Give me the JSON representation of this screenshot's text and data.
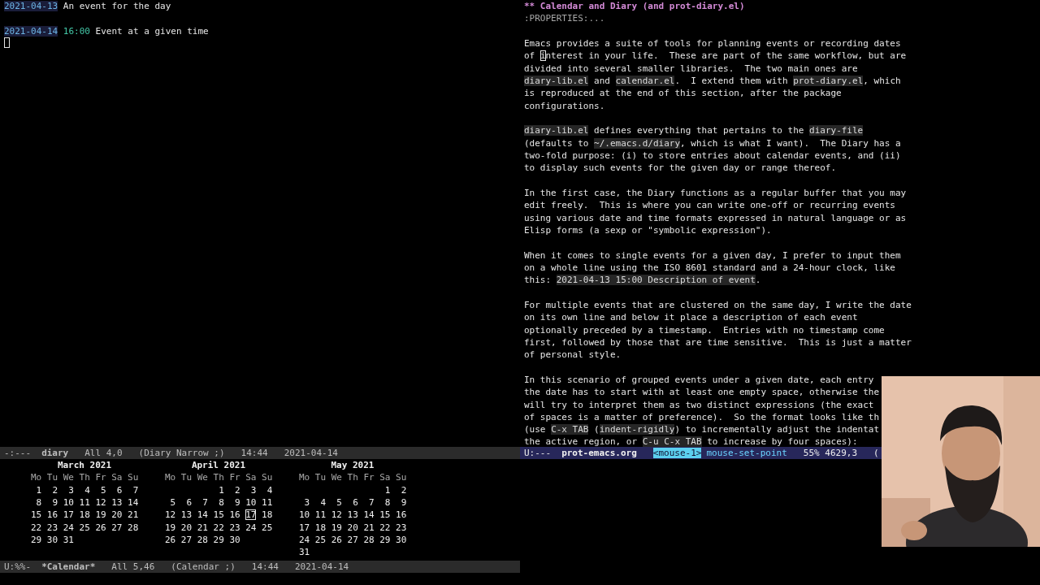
{
  "diary_window": {
    "entries": [
      {
        "date": "2021-04-13",
        "text": "An event for the day"
      },
      {
        "date": "2021-04-14",
        "time": "16:00",
        "text": "Event at a given time"
      }
    ],
    "cursor": true,
    "mode_line": {
      "active": false,
      "segments": [
        {
          "kind": "flags",
          "text": "-:---"
        },
        {
          "kind": "buffer",
          "text": "diary"
        },
        {
          "kind": "plain",
          "text": "All 4,0"
        },
        {
          "kind": "plain",
          "text": "(Diary Narrow ;)"
        },
        {
          "kind": "plain",
          "text": "14:44"
        },
        {
          "kind": "plain",
          "text": "2021-04-14"
        }
      ]
    }
  },
  "calendar_window": {
    "months": [
      {
        "title": "March 2021",
        "weekdays": [
          "Mo",
          "Tu",
          "We",
          "Th",
          "Fr",
          "Sa",
          "Su"
        ],
        "weeks": [
          [
            {
              "day": "1",
              "selected": false
            },
            {
              "day": "2",
              "selected": false
            },
            {
              "day": "3",
              "selected": false
            },
            {
              "day": "4",
              "selected": false
            },
            {
              "day": "5",
              "selected": false
            },
            {
              "day": "6",
              "selected": false
            },
            {
              "day": "7",
              "selected": false
            }
          ],
          [
            {
              "day": "8",
              "selected": false
            },
            {
              "day": "9",
              "selected": false
            },
            {
              "day": "10",
              "selected": false
            },
            {
              "day": "11",
              "selected": false
            },
            {
              "day": "12",
              "selected": false
            },
            {
              "day": "13",
              "selected": false
            },
            {
              "day": "14",
              "selected": false
            }
          ],
          [
            {
              "day": "15",
              "selected": false
            },
            {
              "day": "16",
              "selected": false
            },
            {
              "day": "17",
              "selected": false
            },
            {
              "day": "18",
              "selected": false
            },
            {
              "day": "19",
              "selected": false
            },
            {
              "day": "20",
              "selected": false
            },
            {
              "day": "21",
              "selected": false
            }
          ],
          [
            {
              "day": "22",
              "selected": false
            },
            {
              "day": "23",
              "selected": false
            },
            {
              "day": "24",
              "selected": false
            },
            {
              "day": "25",
              "selected": false
            },
            {
              "day": "26",
              "selected": false
            },
            {
              "day": "27",
              "selected": false
            },
            {
              "day": "28",
              "selected": false
            }
          ],
          [
            {
              "day": "29",
              "selected": false
            },
            {
              "day": "30",
              "selected": false
            },
            {
              "day": "31",
              "selected": false
            }
          ]
        ]
      },
      {
        "title": "April 2021",
        "weekdays": [
          "Mo",
          "Tu",
          "We",
          "Th",
          "Fr",
          "Sa",
          "Su"
        ],
        "weeks": [
          {
            "kind": "leading",
            "days": [
              {
                "day": "1",
                "selected": false
              },
              {
                "day": "2",
                "selected": false
              },
              {
                "day": "3",
                "selected": false
              },
              {
                "day": "4",
                "selected": false
              }
            ]
          },
          [
            {
              "day": "5",
              "selected": false
            },
            {
              "day": "6",
              "selected": false
            },
            {
              "day": "7",
              "selected": false
            },
            {
              "day": "8",
              "selected": false
            },
            {
              "day": "9",
              "selected": false
            },
            {
              "day": "10",
              "selected": false
            },
            {
              "day": "11",
              "selected": false
            }
          ],
          [
            {
              "day": "12",
              "selected": false
            },
            {
              "day": "13",
              "selected": false
            },
            {
              "day": "14",
              "selected": false
            },
            {
              "day": "15",
              "selected": false
            },
            {
              "day": "16",
              "selected": false
            },
            {
              "day": "17",
              "selected": true
            },
            {
              "day": "18",
              "selected": false
            }
          ],
          [
            {
              "day": "19",
              "selected": false
            },
            {
              "day": "20",
              "selected": false
            },
            {
              "day": "21",
              "selected": false
            },
            {
              "day": "22",
              "selected": false
            },
            {
              "day": "23",
              "selected": false
            },
            {
              "day": "24",
              "selected": false
            },
            {
              "day": "25",
              "selected": false
            }
          ],
          [
            {
              "day": "26",
              "selected": false
            },
            {
              "day": "27",
              "selected": false
            },
            {
              "day": "28",
              "selected": false
            },
            {
              "day": "29",
              "selected": false
            },
            {
              "day": "30",
              "selected": false
            }
          ]
        ]
      },
      {
        "title": "May 2021",
        "weekdays": [
          "Mo",
          "Tu",
          "We",
          "Th",
          "Fr",
          "Sa",
          "Su"
        ],
        "weeks": [
          {
            "kind": "leading",
            "days": [
              {
                "day": "1",
                "selected": false
              },
              {
                "day": "2",
                "selected": false
              }
            ]
          },
          [
            {
              "day": "3",
              "selected": false
            },
            {
              "day": "4",
              "selected": false
            },
            {
              "day": "5",
              "selected": false
            },
            {
              "day": "6",
              "selected": false
            },
            {
              "day": "7",
              "selected": false
            },
            {
              "day": "8",
              "selected": false
            },
            {
              "day": "9",
              "selected": false
            }
          ],
          [
            {
              "day": "10",
              "selected": false
            },
            {
              "day": "11",
              "selected": false
            },
            {
              "day": "12",
              "selected": false
            },
            {
              "day": "13",
              "selected": false
            },
            {
              "day": "14",
              "selected": false
            },
            {
              "day": "15",
              "selected": false
            },
            {
              "day": "16",
              "selected": false
            }
          ],
          [
            {
              "day": "17",
              "selected": false
            },
            {
              "day": "18",
              "selected": false
            },
            {
              "day": "19",
              "selected": false
            },
            {
              "day": "20",
              "selected": false
            },
            {
              "day": "21",
              "selected": false
            },
            {
              "day": "22",
              "selected": false
            },
            {
              "day": "23",
              "selected": false
            }
          ],
          [
            {
              "day": "24",
              "selected": false
            },
            {
              "day": "25",
              "selected": false
            },
            {
              "day": "26",
              "selected": false
            },
            {
              "day": "27",
              "selected": false
            },
            {
              "day": "28",
              "selected": false
            },
            {
              "day": "29",
              "selected": false
            },
            {
              "day": "30",
              "selected": false
            }
          ],
          [
            {
              "day": "31",
              "selected": false
            }
          ]
        ]
      }
    ],
    "mode_line": {
      "active": false,
      "segments": [
        {
          "kind": "flags",
          "text": "U:%%-"
        },
        {
          "kind": "buffer",
          "text": "*Calendar*"
        },
        {
          "kind": "plain",
          "text": "All 5,46"
        },
        {
          "kind": "plain",
          "text": "(Calendar ;)"
        },
        {
          "kind": "plain",
          "text": "14:44"
        },
        {
          "kind": "plain",
          "text": "2021-04-14"
        }
      ]
    }
  },
  "org_window": {
    "heading": "** Calendar and Diary (and prot-diary.el)",
    "properties": ":PROPERTIES:...",
    "paragraphs": [
      [
        [
          {
            "kind": "text",
            "text": "Emacs provides a suite of tools for planning events or recording dates"
          }
        ],
        [
          {
            "kind": "text",
            "text": "of "
          },
          {
            "kind": "cursor",
            "text": "i"
          },
          {
            "kind": "text",
            "text": "nterest in your life.  These are part of the same workflow, but are"
          }
        ],
        [
          {
            "kind": "text",
            "text": "divided into several smaller libraries.  The two main ones are"
          }
        ],
        [
          {
            "kind": "code",
            "text": "diary-lib.el"
          },
          {
            "kind": "text",
            "text": " and "
          },
          {
            "kind": "code",
            "text": "calendar.el"
          },
          {
            "kind": "text",
            "text": ".  I extend them with "
          },
          {
            "kind": "code",
            "text": "prot-diary.el"
          },
          {
            "kind": "text",
            "text": ", which"
          }
        ],
        [
          {
            "kind": "text",
            "text": "is reproduced at the end of this section, after the package"
          }
        ],
        [
          {
            "kind": "text",
            "text": "configurations."
          }
        ]
      ],
      [
        [
          {
            "kind": "code",
            "text": "diary-lib.el"
          },
          {
            "kind": "text",
            "text": " defines everything that pertains to the "
          },
          {
            "kind": "code",
            "text": "diary-file"
          }
        ],
        [
          {
            "kind": "text",
            "text": "(defaults to "
          },
          {
            "kind": "code",
            "text": "~/.emacs.d/diary"
          },
          {
            "kind": "text",
            "text": ", which is what I want).  The Diary has a"
          }
        ],
        [
          {
            "kind": "text",
            "text": "two-fold purpose: (i) to store entries about calendar events, and (ii)"
          }
        ],
        [
          {
            "kind": "text",
            "text": "to display such events for the given day or range thereof."
          }
        ]
      ],
      [
        [
          {
            "kind": "text",
            "text": "In the first case, the Diary functions as a regular buffer that you may"
          }
        ],
        [
          {
            "kind": "text",
            "text": "edit freely.  This is where you can write one-off or recurring events"
          }
        ],
        [
          {
            "kind": "text",
            "text": "using various date and time formats expressed in natural language or as"
          }
        ],
        [
          {
            "kind": "text",
            "text": "Elisp forms (a sexp or \"symbolic expression\")."
          }
        ]
      ],
      [
        [
          {
            "kind": "text",
            "text": "When it comes to single events for a given day, I prefer to input them"
          }
        ],
        [
          {
            "kind": "text",
            "text": "on a whole line using the ISO 8601 standard and a 24-hour clock, like"
          }
        ],
        [
          {
            "kind": "text",
            "text": "this: "
          },
          {
            "kind": "code",
            "text": "2021-04-13 15:00 Description of event"
          },
          {
            "kind": "text",
            "text": "."
          }
        ]
      ],
      [
        [
          {
            "kind": "text",
            "text": "For multiple events that are clustered on the same day, I write the date"
          }
        ],
        [
          {
            "kind": "text",
            "text": "on its own line and below it place a description of each event"
          }
        ],
        [
          {
            "kind": "text",
            "text": "optionally preceded by a timestamp.  Entries with no timestamp come"
          }
        ],
        [
          {
            "kind": "text",
            "text": "first, followed by those that are time sensitive.  This is just a matter"
          }
        ],
        [
          {
            "kind": "text",
            "text": "of personal style."
          }
        ]
      ],
      [
        [
          {
            "kind": "text",
            "text": "In this scenario of grouped events under a given date, each entry"
          }
        ],
        [
          {
            "kind": "text",
            "text": "the date has to start with at least one empty space, otherwise the"
          }
        ],
        [
          {
            "kind": "text",
            "text": "will try to interpret them as two distinct expressions (the exact"
          }
        ],
        [
          {
            "kind": "text",
            "text": "of spaces is a matter of preference).  So the format looks like th"
          }
        ],
        [
          {
            "kind": "text",
            "text": "(use "
          },
          {
            "kind": "code",
            "text": "C-x TAB"
          },
          {
            "kind": "text",
            "text": " ("
          },
          {
            "kind": "code",
            "text": "indent-rigidly"
          },
          {
            "kind": "text",
            "text": ") to incrementally adjust the indentat"
          }
        ],
        [
          {
            "kind": "text",
            "text": "the active region, or "
          },
          {
            "kind": "code",
            "text": "C-u C-x TAB"
          },
          {
            "kind": "text",
            "text": " to increase by four spaces):"
          }
        ]
      ]
    ],
    "mode_line": {
      "active": true,
      "segments": [
        {
          "kind": "flags",
          "text": "U:---"
        },
        {
          "kind": "buffer",
          "text": "prot-emacs.org"
        },
        {
          "kind": "key",
          "text": "<mouse-1>"
        },
        {
          "kind": "command",
          "text": "mouse-set-point"
        },
        {
          "kind": "plain",
          "text": "55% 4629,3"
        },
        {
          "kind": "plain",
          "text": "("
        }
      ]
    }
  }
}
